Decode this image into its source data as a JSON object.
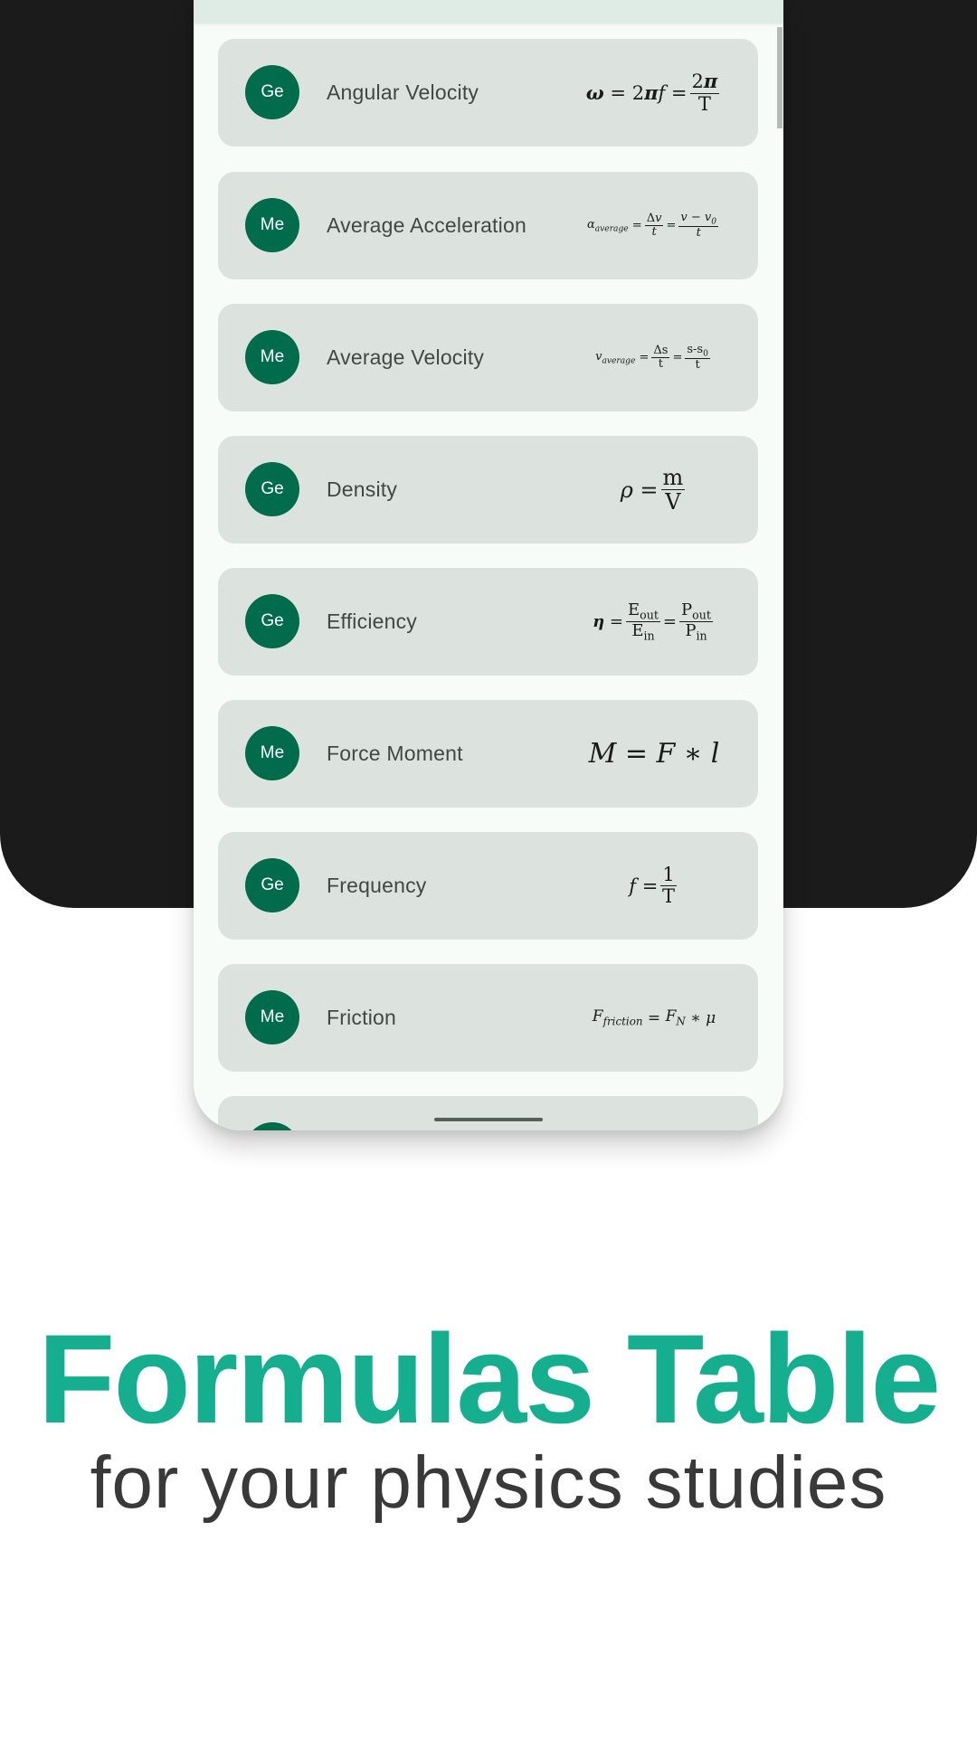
{
  "colors": {
    "background_dark": "#1b1b1b",
    "avatar": "#006c4c",
    "card": "#dce3de",
    "headline": "#15ae8f",
    "subline": "#393939"
  },
  "formulas": [
    {
      "badge": "Ge",
      "name": "Angular Velocity",
      "formula": "ω = 2πf = 2π/T"
    },
    {
      "badge": "Me",
      "name": "Average Acceleration",
      "formula": "α_average = Δv/t = (v − v0)/t"
    },
    {
      "badge": "Me",
      "name": "Average Velocity",
      "formula": "v_average = Δs/t = (s-s0)/t"
    },
    {
      "badge": "Ge",
      "name": "Density",
      "formula": "ρ = m/V"
    },
    {
      "badge": "Ge",
      "name": "Efficiency",
      "formula": "η = Eout/Ein = Pout/Pin"
    },
    {
      "badge": "Me",
      "name": "Force Moment",
      "formula": "M = F * l"
    },
    {
      "badge": "Ge",
      "name": "Frequency",
      "formula": "f = 1/T"
    },
    {
      "badge": "Me",
      "name": "Friction",
      "formula": "F_friction = F_N * μ"
    }
  ],
  "promo": {
    "headline": "Formulas Table",
    "subline": "for your physics studies"
  }
}
